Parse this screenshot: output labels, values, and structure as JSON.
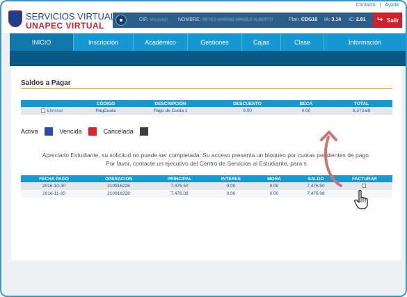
{
  "top_links": {
    "contact": "Contacto",
    "sep": "|",
    "help": "Ayuda"
  },
  "logo": {
    "line1": "SERVICIOS VIRTUALES",
    "line2": "UNAPEC VIRTUAL"
  },
  "userbar": {
    "cif_label": "CIF:",
    "cif_value": "20131421",
    "name_label": "NOMBRE:",
    "name_value": "REYES MARIÑO ARNOLD ALBERTO",
    "plan_label": "Plan:",
    "plan_value": "CDG10",
    "ia_label": "IA:",
    "ia_value": "3.14",
    "ic_label": "IC:",
    "ic_value": "2.81"
  },
  "salir_label": "Salir",
  "nav": [
    "INICIO",
    "Inscripción",
    "Académico",
    "Gestiones",
    "Cajas",
    "Clase",
    "Información"
  ],
  "page_title": "Saldos a Pagar",
  "saldos_table": {
    "headers": [
      "CÓDIGO",
      "DESCRIPCIÓN",
      "DESCUENTO",
      "BECA",
      "TOTAL"
    ],
    "rows": [
      {
        "eliminar": "Eliminar",
        "codigo": "PagCuota",
        "descripcion": "Pago de Cuota 1",
        "descuento": "0.00",
        "beca": "0.00",
        "total": "8,373.68"
      }
    ]
  },
  "legend": [
    {
      "label": "Activa",
      "color": "#2e4aa3"
    },
    {
      "label": "Vencida",
      "color": "#e0212f"
    },
    {
      "label": "Cancelada",
      "color": "#3d3d3d"
    }
  ],
  "message": {
    "line1": "Apreciado Estudiante, su solicitud no puede ser completada. Su acceso presenta un bloqueo por cuotas pendientes de pago.",
    "line2": "Por favor, contacte un ejecutivo del Centro de Servicios al Estudiante, para s"
  },
  "cuotas_table": {
    "headers": [
      "FECHA PAGO",
      "OPERACION",
      "PRINCIPAL",
      "INTERES",
      "MORA",
      "SALDO",
      "FACTURAR"
    ],
    "rows": [
      {
        "fecha": "2016-10-30",
        "operacion": "210916228",
        "principal": "7,476.50",
        "interes": "0.00",
        "mora": "0.00",
        "saldo": "7,476.50"
      },
      {
        "fecha": "2016-11-30",
        "operacion": "210916228",
        "principal": "7,476.08",
        "interes": "0.00",
        "mora": "0.00",
        "saldo": "7,476.08"
      }
    ]
  },
  "annotation_color": "#c9757a"
}
